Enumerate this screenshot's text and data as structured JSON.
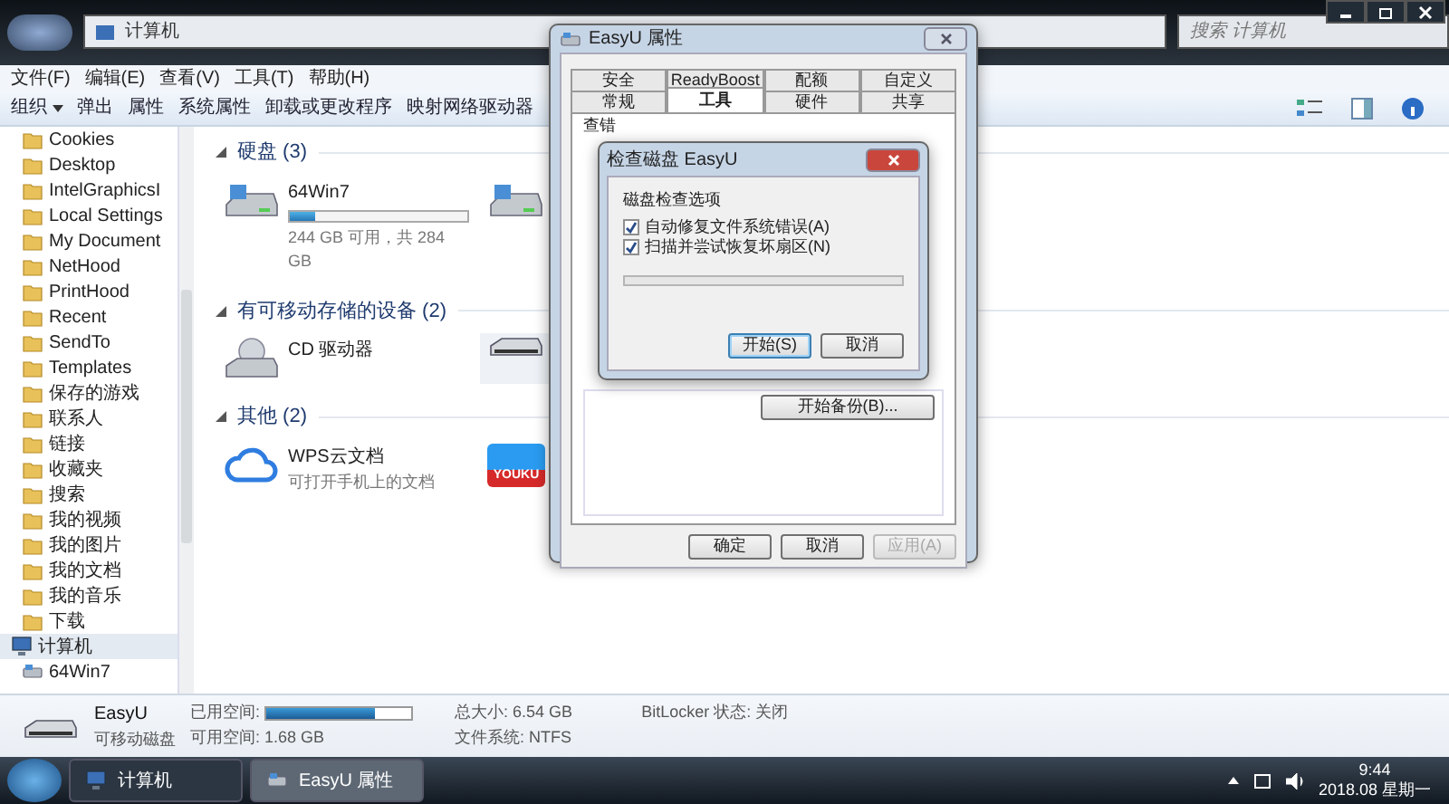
{
  "explorer": {
    "address": [
      "计算机"
    ],
    "search_placeholder": "搜索 计算机",
    "menu": [
      "文件(F)",
      "编辑(E)",
      "查看(V)",
      "工具(T)",
      "帮助(H)"
    ],
    "toolbar": [
      {
        "label": "组织",
        "kind": "menu"
      },
      {
        "label": "弹出",
        "kind": "command"
      },
      {
        "label": "属性",
        "kind": "command"
      },
      {
        "label": "系统属性",
        "kind": "command"
      },
      {
        "label": "卸载或更改程序",
        "kind": "command"
      },
      {
        "label": "映射网络驱动器",
        "kind": "command"
      }
    ],
    "nav": [
      {
        "label": "Cookies",
        "kind": "folder",
        "selected": false
      },
      {
        "label": "Desktop",
        "kind": "folder",
        "selected": false
      },
      {
        "label": "IntelGraphicsI",
        "kind": "folder",
        "selected": false
      },
      {
        "label": "Local Settings",
        "kind": "folder",
        "selected": false
      },
      {
        "label": "My Document",
        "kind": "folder",
        "selected": false
      },
      {
        "label": "NetHood",
        "kind": "folder",
        "selected": false
      },
      {
        "label": "PrintHood",
        "kind": "folder",
        "selected": false
      },
      {
        "label": "Recent",
        "kind": "folder",
        "selected": false
      },
      {
        "label": "SendTo",
        "kind": "folder",
        "selected": false
      },
      {
        "label": "Templates",
        "kind": "folder",
        "selected": false
      },
      {
        "label": "保存的游戏",
        "kind": "folder",
        "selected": false
      },
      {
        "label": "联系人",
        "kind": "folder",
        "selected": false
      },
      {
        "label": "链接",
        "kind": "folder",
        "selected": false
      },
      {
        "label": "收藏夹",
        "kind": "folder",
        "selected": false
      },
      {
        "label": "搜索",
        "kind": "folder",
        "selected": false
      },
      {
        "label": "我的视频",
        "kind": "folder",
        "selected": false
      },
      {
        "label": "我的图片",
        "kind": "folder",
        "selected": false
      },
      {
        "label": "我的文档",
        "kind": "folder",
        "selected": false
      },
      {
        "label": "我的音乐",
        "kind": "folder",
        "selected": false
      },
      {
        "label": "下载",
        "kind": "folder",
        "selected": false
      },
      {
        "label": "计算机",
        "kind": "computer",
        "selected": true
      },
      {
        "label": "64Win7",
        "kind": "drive",
        "selected": false
      }
    ],
    "groups": [
      {
        "title": "硬盘 (3)",
        "items": [
          {
            "kind": "hdd",
            "name": "64Win7",
            "level": 0.14,
            "info": "244 GB 可用，共 284 GB",
            "selected": false
          },
          {
            "kind": "hdd",
            "selected": false
          }
        ]
      },
      {
        "title": "有可移动存储的设备 (2)",
        "items": [
          {
            "kind": "cd",
            "name": "CD 驱动器",
            "selected": false
          },
          {
            "kind": "removable",
            "selected": true
          }
        ]
      },
      {
        "title": "其他 (2)",
        "items": [
          {
            "kind": "cloud",
            "name": "WPS云文档",
            "info": "可打开手机上的文档",
            "selected": false
          },
          {
            "kind": "app",
            "badge": "YOUKU",
            "selected": false
          }
        ]
      }
    ],
    "details": {
      "name": "EasyU",
      "type": "可移动磁盘",
      "used_label": "已用空间:",
      "level": 0.75,
      "free_label": "可用空间:",
      "free": "1.68 GB",
      "total_label": "总大小:",
      "total": "6.54 GB",
      "fs_label": "文件系统:",
      "fs": "NTFS",
      "bitlocker_label": "BitLocker 状态:",
      "bitlocker": "关闭"
    }
  },
  "properties_dialog": {
    "title": "EasyU 属性",
    "tabs": [
      [
        {
          "label": "安全",
          "selected": false
        },
        {
          "label": "ReadyBoost",
          "selected": false
        },
        {
          "label": "配额",
          "selected": false
        },
        {
          "label": "自定义",
          "selected": false
        }
      ],
      [
        {
          "label": "常规",
          "selected": false
        },
        {
          "label": "工具",
          "selected": true
        },
        {
          "label": "硬件",
          "selected": false
        },
        {
          "label": "共享",
          "selected": false
        }
      ]
    ],
    "group_label": "查错",
    "backup_button": "开始备份(B)...",
    "buttons": [
      {
        "label": "确定",
        "disabled": false
      },
      {
        "label": "取消",
        "disabled": false
      },
      {
        "label": "应用(A)",
        "disabled": true
      }
    ]
  },
  "check_disk_dialog": {
    "title": "检查磁盘 EasyU",
    "section": "磁盘检查选项",
    "options": [
      {
        "label": "自动修复文件系统错误(A)",
        "checked": true
      },
      {
        "label": "扫描并尝试恢复坏扇区(N)",
        "checked": true
      }
    ],
    "level": 0,
    "buttons": [
      {
        "label": "开始(S)",
        "default": true
      },
      {
        "label": "取消",
        "default": false
      }
    ]
  },
  "taskbar": {
    "tasks": [
      {
        "label": "计算机",
        "kind": "computer",
        "selected": false
      },
      {
        "label": "EasyU 属性",
        "kind": "drive",
        "selected": true
      }
    ],
    "time": "9:44",
    "date": "2018.08 星期一"
  }
}
